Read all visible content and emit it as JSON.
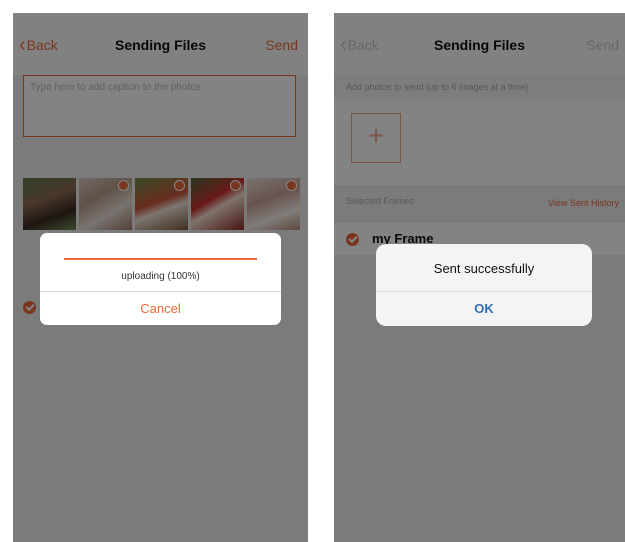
{
  "left_screen": {
    "nav": {
      "back_label": "Back",
      "title": "Sending Files",
      "action_label": "Send"
    },
    "caption_placeholder": "Type here to add caption to the photos",
    "upload_dialog": {
      "progress": 1.0,
      "status_text": "uploading  (100%)",
      "cancel_label": "Cancel"
    }
  },
  "right_screen": {
    "nav": {
      "back_label": "Back",
      "title": "Sending Files",
      "action_label": "Send"
    },
    "hint": "Add photos to send (up to 6 images at a time)",
    "add_button_label": "+",
    "selected_frames_label": "Selected Frames",
    "view_history_label": "View Sent History",
    "frame_name": "my Frame",
    "alert": {
      "message": "Sent successfully",
      "ok_label": "OK"
    }
  },
  "colors": {
    "accent": "#e8693d",
    "ios_blue": "#2f6db5"
  }
}
